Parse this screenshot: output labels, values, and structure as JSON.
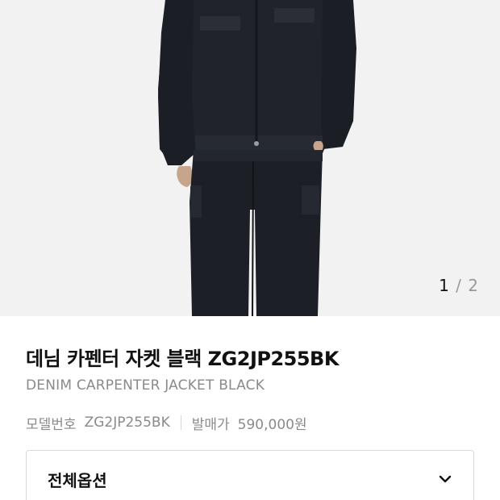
{
  "gallery": {
    "current_index": "1",
    "separator": "/",
    "total": "2",
    "image_subject": "denim-jacket-and-cargo-pants"
  },
  "product": {
    "name": "데님 카펜터 자켓 블랙 ZG2JP255BK",
    "name_en": "DENIM CARPENTER JACKET BLACK",
    "model_label": "모델번호",
    "model_value": "ZG2JP255BK",
    "release_label": "발매가",
    "release_value": "590,000원"
  },
  "options": {
    "label": "전체옵션",
    "icon": "chevron-down-icon"
  },
  "colors": {
    "background": "#ffffff",
    "image_bg": "#f3f3f3",
    "denim": "#1f222a",
    "muted_text": "#8a8a8a"
  }
}
